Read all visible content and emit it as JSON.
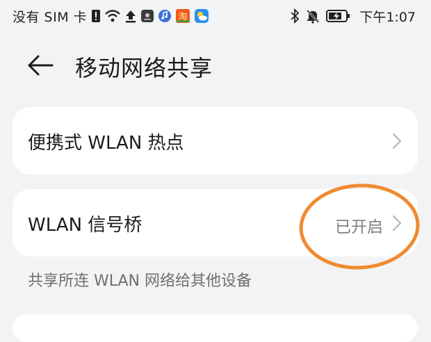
{
  "status_bar": {
    "carrier": "没有 SIM 卡",
    "time": "下午1:07",
    "icons_left": [
      "sim-alert-icon",
      "wifi-icon",
      "upload-icon",
      "huawei-app-icon",
      "music-app-icon",
      "taobao-app-icon",
      "weather-app-icon"
    ],
    "icons_right": [
      "bluetooth-icon",
      "mute-bell-icon",
      "battery-charging-icon"
    ],
    "taobao_text": "淘"
  },
  "header": {
    "title": "移动网络共享"
  },
  "settings": {
    "hotspot": {
      "label": "便携式 WLAN 热点"
    },
    "bridge": {
      "label": "WLAN 信号桥",
      "status": "已开启"
    },
    "bridge_description": "共享所连 WLAN 网络给其他设备"
  },
  "colors": {
    "background": "#f1f3f5",
    "card": "#ffffff",
    "annotation_circle": "#f08a2f"
  }
}
